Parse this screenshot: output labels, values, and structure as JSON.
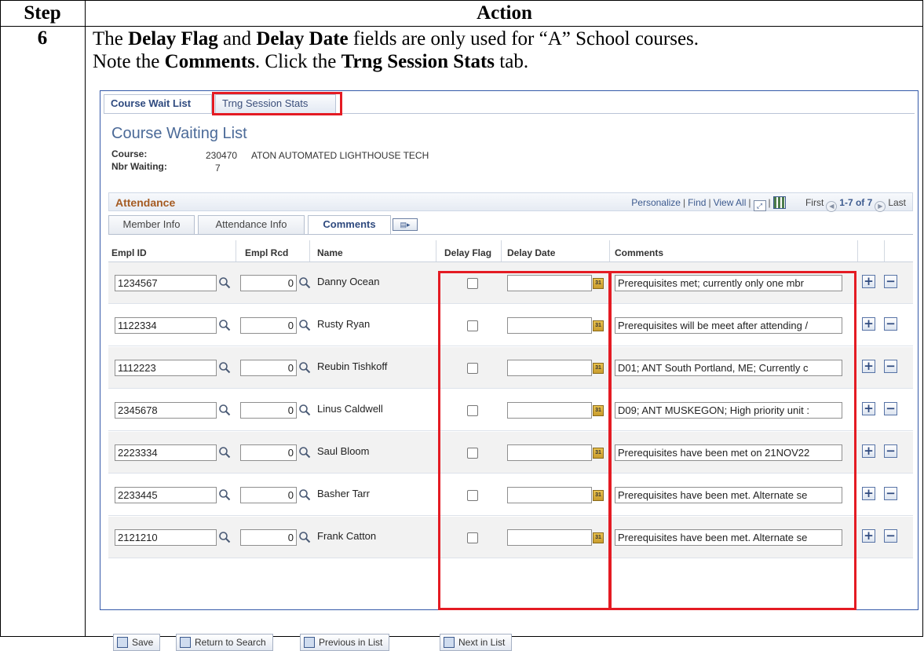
{
  "doc": {
    "header_step": "Step",
    "header_action": "Action",
    "step_number": "6",
    "line1": {
      "t1": "The ",
      "b1": "Delay Flag",
      "t2": " and ",
      "b2": "Delay Date",
      "t3": " fields are only used for “A” School courses."
    },
    "line2": {
      "t1": "Note the ",
      "b1": "Comments",
      "t2": ". Click the ",
      "b2": "Trng Session Stats",
      "t3": " tab."
    }
  },
  "page_tabs": [
    "Course Wait List",
    "Trng Session Stats"
  ],
  "page_title": "Course Waiting List",
  "course_label": "Course:",
  "course_code": "230470",
  "course_name": "ATON AUTOMATED LIGHTHOUSE TECH",
  "waiting_label": "Nbr Waiting:",
  "waiting_count": "7",
  "grid": {
    "title": "Attendance",
    "personalize": "Personalize",
    "find": "Find",
    "view_all": "View All",
    "first": "First",
    "range": "1-7 of 7",
    "last": "Last",
    "sub_tabs": [
      "Member Info",
      "Attendance Info",
      "Comments"
    ],
    "columns": [
      "Empl ID",
      "Empl Rcd",
      "Name",
      "Delay Flag",
      "Delay Date",
      "Comments"
    ],
    "rows": [
      {
        "id": "1234567",
        "rcd": "0",
        "name": "Danny Ocean",
        "comment": "Prerequisites met; currently only one mbr"
      },
      {
        "id": "1122334",
        "rcd": "0",
        "name": "Rusty Ryan",
        "comment": "Prerequisites will be meet after attending /"
      },
      {
        "id": "1112223",
        "rcd": "0",
        "name": "Reubin Tishkoff",
        "comment": "D01; ANT South Portland, ME; Currently c"
      },
      {
        "id": "2345678",
        "rcd": "0",
        "name": "Linus Caldwell",
        "comment": "D09; ANT MUSKEGON; High priority unit :"
      },
      {
        "id": "2223334",
        "rcd": "0",
        "name": "Saul Bloom",
        "comment": "Prerequisites have been met on 21NOV22"
      },
      {
        "id": "2233445",
        "rcd": "0",
        "name": "Basher Tarr",
        "comment": "Prerequisites have been met. Alternate se"
      },
      {
        "id": "2121210",
        "rcd": "0",
        "name": "Frank Catton",
        "comment": "Prerequisites have been met. Alternate se"
      }
    ]
  },
  "buttons": {
    "save": "Save",
    "return": "Return to Search",
    "previous": "Previous in List",
    "next": "Next in List"
  },
  "highlight_color": "#e41b23"
}
